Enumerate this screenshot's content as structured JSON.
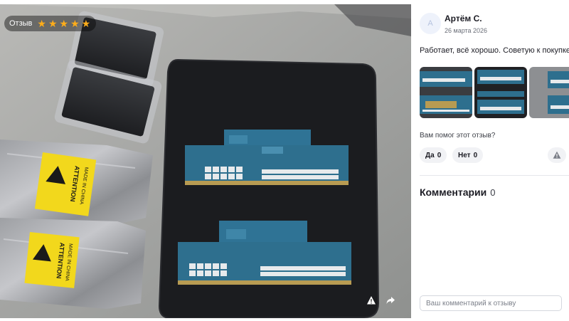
{
  "photo": {
    "rating_label": "Отзыв",
    "rating": 5,
    "rating_max": 5,
    "stars": [
      "★",
      "★",
      "★",
      "★",
      "★"
    ],
    "package_labels": {
      "attention": "ATTENTION",
      "made_in": "MADE IN CHINA"
    },
    "report_icon": "alert-icon",
    "share_icon": "share-arrow-icon"
  },
  "review": {
    "author_name": "Артём С.",
    "avatar_initial": "А",
    "date": "26 марта 2026",
    "text": "Работает, всё хорошо. Советую к покупке.",
    "helpful_question": "Вам помог этот отзыв?",
    "votes": {
      "yes_label": "Да",
      "yes_count": "0",
      "no_label": "Нет",
      "no_count": "0"
    }
  },
  "comments": {
    "title": "Комментарии",
    "count": "0",
    "input_placeholder": "Ваш комментарий к отзыву",
    "input_value": ""
  },
  "colors": {
    "accent_star": "#ffad1a",
    "text_primary": "#1c1c24",
    "chip_bg": "#f1f2f5",
    "pcb": "#2e6f8e"
  }
}
